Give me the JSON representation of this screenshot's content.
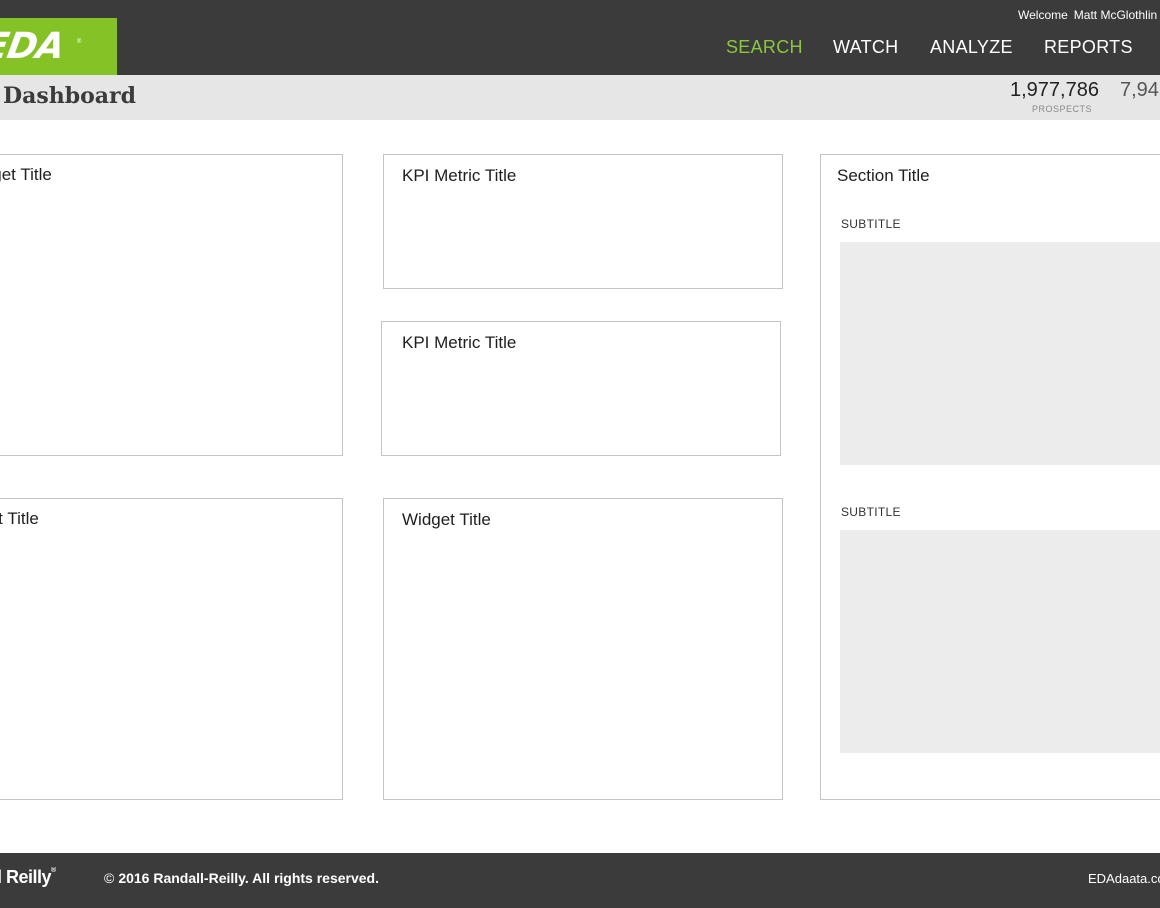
{
  "header": {
    "logo_text": "EDA",
    "logo_reg": "®",
    "welcome_label": "Welcome",
    "user_name": "Matt McGlothlin",
    "nav": [
      {
        "label": "SEARCH",
        "active": true
      },
      {
        "label": "WATCH",
        "active": false
      },
      {
        "label": "ANALYZE",
        "active": false
      },
      {
        "label": "REPORTS",
        "active": false
      }
    ],
    "accent_color": "#84c225",
    "active_nav_color": "#8bc63f",
    "bar_color": "#3b3b3b"
  },
  "subheader": {
    "title": "Dashboard",
    "stats": [
      {
        "value": "1,977,786",
        "label": "PROSPECTS"
      },
      {
        "value": "7,94",
        "label": ""
      }
    ]
  },
  "widgets": {
    "left_top_title": "Widget Title",
    "left_bottom_title": "Widget Title",
    "kpi_1_title": "KPI  Metric Title",
    "kpi_2_title": "KPI Metric Title",
    "center_bottom_title": "Widget Title"
  },
  "section": {
    "title": "Section Title",
    "subtitle_1": "SUBTITLE",
    "subtitle_2": "SUBTITLE"
  },
  "footer": {
    "brand": "Randall Reilly",
    "brand_reg": "®",
    "copyright_symbol": "©",
    "copyright_text": "2016 Randall-Reilly. All rights reserved.",
    "site_link": "EDAdaata.com"
  }
}
